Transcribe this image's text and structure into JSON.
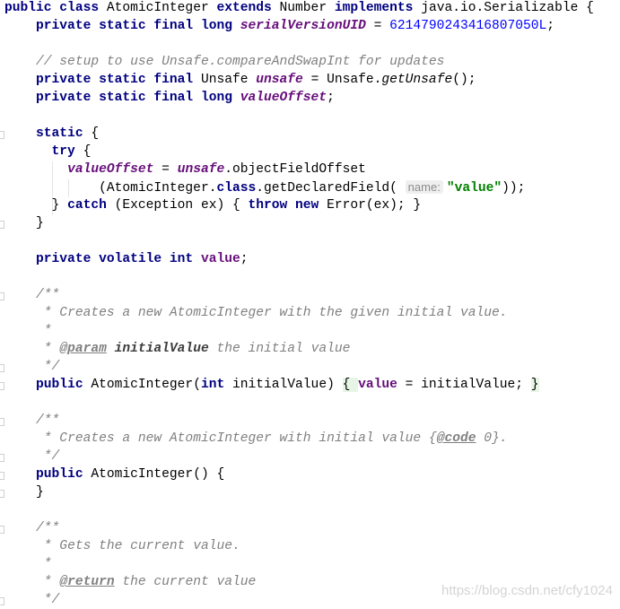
{
  "code_lines": [
    [
      [
        "kw",
        "public class "
      ],
      [
        "plain",
        "AtomicInteger "
      ],
      [
        "kw",
        "extends "
      ],
      [
        "plain",
        "Number "
      ],
      [
        "kw",
        "implements "
      ],
      [
        "plain",
        "java.io.Serializable {"
      ]
    ],
    [
      [
        "plain",
        "    "
      ],
      [
        "kw",
        "private static final long "
      ],
      [
        "sfield",
        "serialVersionUID"
      ],
      [
        "plain",
        " = "
      ],
      [
        "num",
        "6214790243416807050L"
      ],
      [
        "plain",
        ";"
      ]
    ],
    [],
    [
      [
        "plain",
        "    "
      ],
      [
        "comment",
        "// setup to use Unsafe.compareAndSwapInt for updates"
      ]
    ],
    [
      [
        "plain",
        "    "
      ],
      [
        "kw",
        "private static final "
      ],
      [
        "plain",
        "Unsafe "
      ],
      [
        "sfield",
        "unsafe"
      ],
      [
        "plain",
        " = Unsafe."
      ],
      [
        "smethod",
        "getUnsafe"
      ],
      [
        "plain",
        "();"
      ]
    ],
    [
      [
        "plain",
        "    "
      ],
      [
        "kw",
        "private static final long "
      ],
      [
        "sfield",
        "valueOffset"
      ],
      [
        "plain",
        ";"
      ]
    ],
    [],
    [
      [
        "plain",
        "    "
      ],
      [
        "kw",
        "static "
      ],
      [
        "plain",
        "{"
      ]
    ],
    [
      [
        "plain",
        "      "
      ],
      [
        "kw",
        "try "
      ],
      [
        "plain",
        "{"
      ]
    ],
    [
      [
        "plain",
        "        "
      ],
      [
        "sfield",
        "valueOffset"
      ],
      [
        "plain",
        " = "
      ],
      [
        "sfield",
        "unsafe"
      ],
      [
        "plain",
        ".objectFieldOffset"
      ]
    ],
    [
      [
        "plain",
        "            (AtomicInteger."
      ],
      [
        "kw",
        "class"
      ],
      [
        "plain",
        ".getDeclaredField( "
      ],
      [
        "hint",
        "name:"
      ],
      [
        "str",
        "\"value\""
      ],
      [
        "plain",
        "));"
      ]
    ],
    [
      [
        "plain",
        "      } "
      ],
      [
        "kw",
        "catch "
      ],
      [
        "plain",
        "(Exception ex) { "
      ],
      [
        "kw",
        "throw new "
      ],
      [
        "plain",
        "Error(ex); }"
      ]
    ],
    [
      [
        "plain",
        "    }"
      ]
    ],
    [],
    [
      [
        "plain",
        "    "
      ],
      [
        "kw",
        "private volatile int "
      ],
      [
        "field",
        "value"
      ],
      [
        "plain",
        ";"
      ]
    ],
    [],
    [
      [
        "plain",
        "    "
      ],
      [
        "comment",
        "/**"
      ]
    ],
    [
      [
        "plain",
        "     "
      ],
      [
        "comment",
        "* Creates a new AtomicInteger with the given initial value."
      ]
    ],
    [
      [
        "plain",
        "     "
      ],
      [
        "comment",
        "*"
      ]
    ],
    [
      [
        "plain",
        "     "
      ],
      [
        "comment",
        "* "
      ],
      [
        "doctag",
        "@param"
      ],
      [
        "comment",
        " "
      ],
      [
        "docparam",
        "initialValue"
      ],
      [
        "comment",
        " the initial value"
      ]
    ],
    [
      [
        "plain",
        "     "
      ],
      [
        "comment",
        "*/"
      ]
    ],
    [
      [
        "plain",
        "    "
      ],
      [
        "kw",
        "public "
      ],
      [
        "plain",
        "AtomicInteger("
      ],
      [
        "kw",
        "int "
      ],
      [
        "plain",
        "initialValue) "
      ],
      [
        "brace",
        "{ "
      ],
      [
        "field",
        "value"
      ],
      [
        "plain",
        " = initialValue; "
      ],
      [
        "brace",
        "}"
      ]
    ],
    [],
    [
      [
        "plain",
        "    "
      ],
      [
        "comment",
        "/**"
      ]
    ],
    [
      [
        "plain",
        "     "
      ],
      [
        "comment",
        "* Creates a new AtomicInteger with initial value {"
      ],
      [
        "doctag",
        "@code"
      ],
      [
        "comment",
        " 0}."
      ]
    ],
    [
      [
        "plain",
        "     "
      ],
      [
        "comment",
        "*/"
      ]
    ],
    [
      [
        "plain",
        "    "
      ],
      [
        "kw",
        "public "
      ],
      [
        "plain",
        "AtomicInteger() {"
      ]
    ],
    [
      [
        "plain",
        "    }"
      ]
    ],
    [],
    [
      [
        "plain",
        "    "
      ],
      [
        "comment",
        "/**"
      ]
    ],
    [
      [
        "plain",
        "     "
      ],
      [
        "comment",
        "* Gets the current value."
      ]
    ],
    [
      [
        "plain",
        "     "
      ],
      [
        "comment",
        "*"
      ]
    ],
    [
      [
        "plain",
        "     "
      ],
      [
        "comment",
        "* "
      ],
      [
        "doctag",
        "@return"
      ],
      [
        "comment",
        " the current value"
      ]
    ],
    [
      [
        "plain",
        "     "
      ],
      [
        "comment",
        "*/"
      ]
    ]
  ],
  "watermark": "https://blog.csdn.net/cfy1024"
}
